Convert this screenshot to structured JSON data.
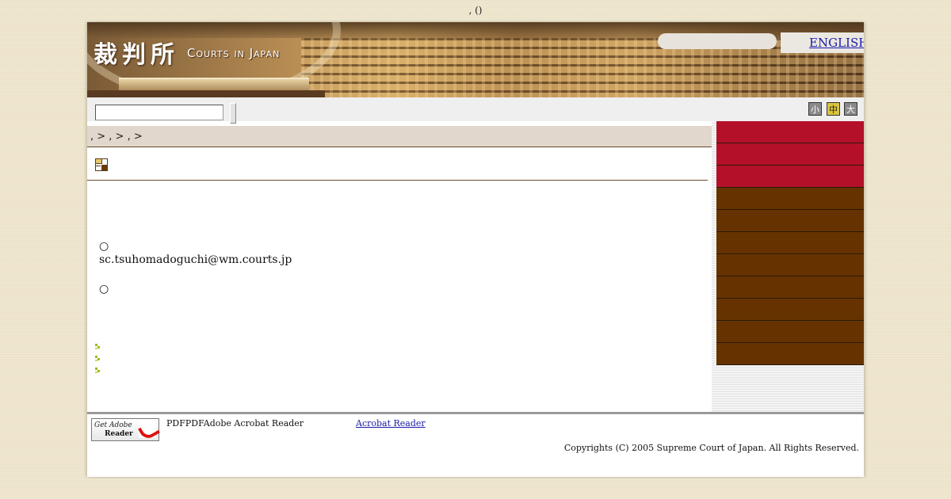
{
  "top_note": ", ()",
  "header": {
    "logo_kanji": "裁判所",
    "logo_english": "Courts in Japan",
    "search_value": "",
    "english_link": "ENGLISH"
  },
  "toolbar": {
    "search_value": "",
    "font_size_buttons": [
      "小",
      "中",
      "大"
    ]
  },
  "breadcrumb": ", > , > , >",
  "content": {
    "lines": [
      "○",
      "sc.tsuhomadoguchi@wm.courts.jp",
      "○"
    ],
    "bullet_items": [
      "",
      "",
      ""
    ]
  },
  "sidebar": {
    "items": [
      {
        "label": "",
        "color": "#b5102a"
      },
      {
        "label": "",
        "color": "#b5102a"
      },
      {
        "label": "",
        "color": "#b5102a"
      },
      {
        "label": "",
        "color": "#663300"
      },
      {
        "label": "",
        "color": "#663300"
      },
      {
        "label": "",
        "color": "#663300"
      },
      {
        "label": "",
        "color": "#663300"
      },
      {
        "label": "",
        "color": "#663300"
      },
      {
        "label": "",
        "color": "#663300"
      },
      {
        "label": "",
        "color": "#663300"
      },
      {
        "label": "",
        "color": "#663300"
      }
    ]
  },
  "footer": {
    "adobe_badge_line1": "Get Adobe",
    "adobe_badge_line2": "Reader",
    "pdf_text": "PDFPDFAdobe Acrobat Reader",
    "acrobat_link": "Acrobat Reader",
    "copyright": "Copyrights (C) 2005 Supreme Court of Japan. All Rights Reserved."
  },
  "colors": {
    "accent_red": "#b5102a",
    "accent_brown": "#663300",
    "background": "#ece3c9"
  }
}
